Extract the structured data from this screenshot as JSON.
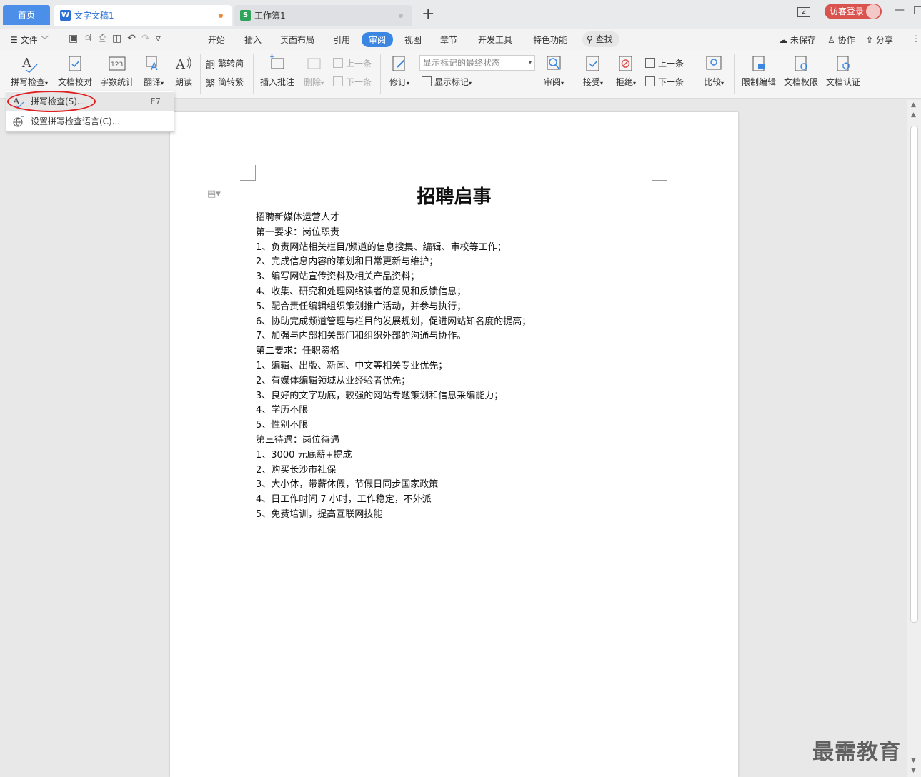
{
  "tabs": {
    "home": "首页",
    "doc": "文字文稿1",
    "sheet": "工作簿1",
    "new_tab": "+",
    "doc_dot_color": "#f0883a",
    "sheet_dot_color": "#bbbbbb"
  },
  "titlebar": {
    "window_count": "2",
    "login": "访客登录",
    "minimize": "—",
    "restore": "□"
  },
  "menu": {
    "file": "文件",
    "tabs": [
      "开始",
      "插入",
      "页面布局",
      "引用",
      "审阅",
      "视图",
      "章节",
      "开发工具",
      "特色功能"
    ],
    "active_tab": "审阅",
    "search": "查找",
    "unsaved": "未保存",
    "collaborate": "协作",
    "share": "分享"
  },
  "ribbon": {
    "spell_check": "拼写检查",
    "doc_proof": "文档校对",
    "word_count": "字数统计",
    "translate": "翻译",
    "read_aloud": "朗读",
    "trad_to_simp": "繁转简",
    "simp_to_trad": "简转繁",
    "insert_comment": "插入批注",
    "delete": "删除",
    "prev_comment": "上一条",
    "next_comment": "下一条",
    "revise": "修订",
    "markup_state": "显示标记的最终状态",
    "show_markup": "显示标记",
    "review": "审阅",
    "accept": "接受",
    "reject": "拒绝",
    "prev_change": "上一条",
    "next_change": "下一条",
    "compare": "比较",
    "restrict_edit": "限制编辑",
    "doc_rights": "文档权限",
    "doc_cert": "文档认证"
  },
  "dropdown": {
    "items": [
      {
        "label": "拼写检查(S)...",
        "shortcut": "F7"
      },
      {
        "label": "设置拼写检查语言(C)...",
        "shortcut": ""
      }
    ]
  },
  "document": {
    "title": "招聘启事",
    "lines": [
      "招聘新媒体运营人才",
      "第一要求：岗位职责",
      "1、负责网站相关栏目/频道的信息搜集、编辑、审校等工作；",
      "2、完成信息内容的策划和日常更新与维护；",
      "3、编写网站宣传资料及相关产品资料；",
      "4、收集、研究和处理网络读者的意见和反馈信息；",
      "5、配合责任编辑组织策划推广活动，并参与执行；",
      "6、协助完成频道管理与栏目的发展规划，促进网站知名度的提高；",
      "7、加强与内部相关部门和组织外部的沟通与协作。",
      "第二要求：任职资格",
      "1、编辑、出版、新闻、中文等相关专业优先；",
      "2、有媒体编辑领域从业经验者优先；",
      "3、良好的文字功底，较强的网站专题策划和信息采编能力；",
      "4、学历不限",
      "5、性别不限",
      "第三待遇：岗位待遇",
      "1、3000 元底薪+提成",
      "2、购买长沙市社保",
      "3、大小休，带薪休假，节假日同步国家政策",
      "4、日工作时间 7 小时，工作稳定，不外派",
      "5、免费培训，提高互联网技能"
    ]
  },
  "watermark": "最需教育",
  "colors": {
    "accent": "#3a86e0",
    "home_tab": "#4c8fe8",
    "login": "#d9534f",
    "highlight_ellipse": "#e02020"
  }
}
